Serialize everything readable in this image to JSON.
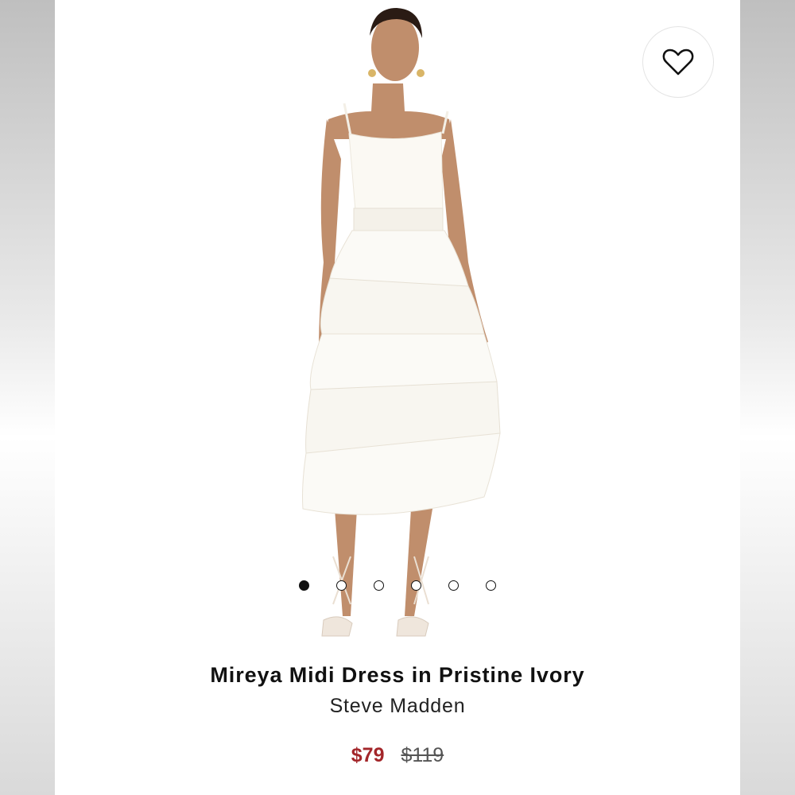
{
  "product": {
    "title": "Mireya Midi Dress in Pristine Ivory",
    "brand": "Steve Madden",
    "sale_price": "$79",
    "original_price": "$119"
  },
  "gallery": {
    "dot_count": 6,
    "active_index": 0
  },
  "icons": {
    "favorite": "heart-outline-icon"
  },
  "colors": {
    "sale_price": "#a3262a",
    "active_dot": "#111111"
  }
}
